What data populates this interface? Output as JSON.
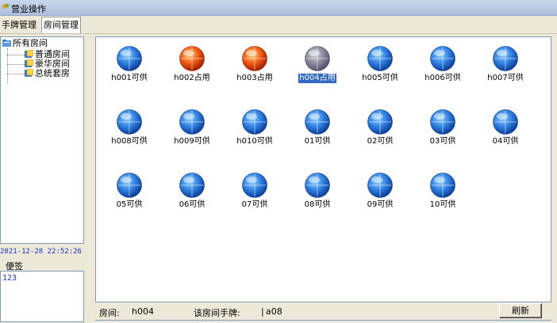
{
  "window": {
    "title": "营业操作"
  },
  "tabs": [
    {
      "label": "手牌管理"
    },
    {
      "label": "房间管理"
    }
  ],
  "tree": {
    "root": "所有房间",
    "children": [
      "普通房间",
      "豪华房间",
      "总统套房"
    ]
  },
  "datetime": "2021-12-28 22:52:26",
  "note": {
    "legend": "便签",
    "text": "123"
  },
  "rooms": [
    {
      "label": "h001可供",
      "status": "available"
    },
    {
      "label": "h002占用",
      "status": "occupied"
    },
    {
      "label": "h003占用",
      "status": "occupied"
    },
    {
      "label": "h004占用",
      "status": "selected"
    },
    {
      "label": "h005可供",
      "status": "available"
    },
    {
      "label": "h006可供",
      "status": "available"
    },
    {
      "label": "h007可供",
      "status": "available"
    },
    {
      "label": "h008可供",
      "status": "available"
    },
    {
      "label": "h009可供",
      "status": "available"
    },
    {
      "label": "h010可供",
      "status": "available"
    },
    {
      "label": "01可供",
      "status": "available"
    },
    {
      "label": "02可供",
      "status": "available"
    },
    {
      "label": "03可供",
      "status": "available"
    },
    {
      "label": "04可供",
      "status": "available"
    },
    {
      "label": "05可供",
      "status": "available"
    },
    {
      "label": "06可供",
      "status": "available"
    },
    {
      "label": "07可供",
      "status": "available"
    },
    {
      "label": "08可供",
      "status": "available"
    },
    {
      "label": "09可供",
      "status": "available"
    },
    {
      "label": "10可供",
      "status": "available"
    }
  ],
  "status": {
    "room_label": "房间:",
    "room_value": "h004",
    "card_label": "该房间手牌:",
    "card_value": "a08",
    "refresh_label": "刷新"
  },
  "colors": {
    "available": "#2f7fe0",
    "occupied": "#f05a10",
    "selected": "#8a8a9a"
  }
}
